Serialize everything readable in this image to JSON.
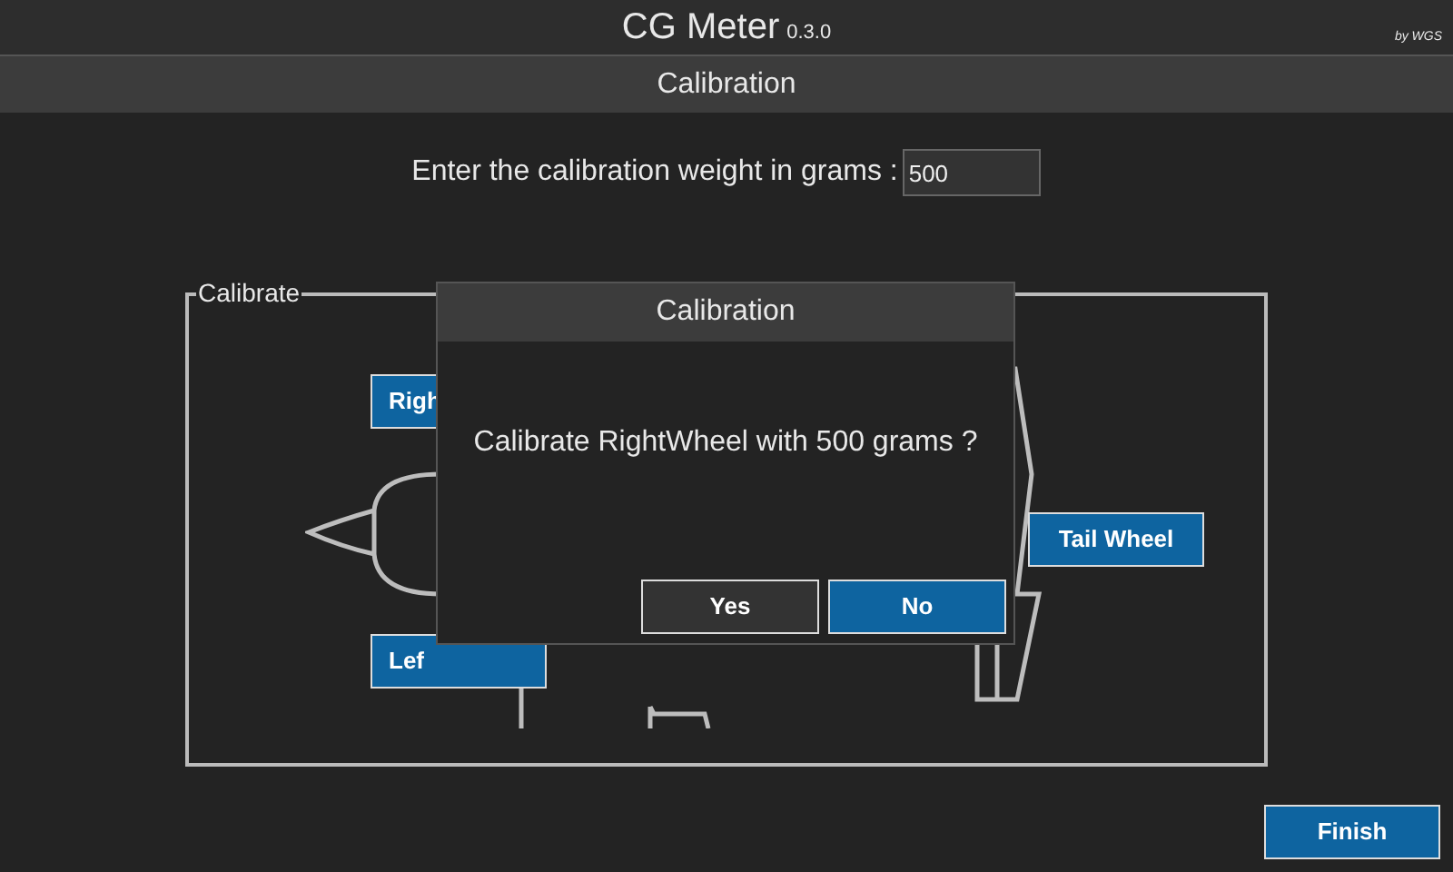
{
  "app": {
    "title": "CG Meter",
    "version": "0.3.0",
    "credit": "by WGS"
  },
  "section": {
    "title": "Calibration"
  },
  "weight": {
    "label": "Enter the calibration weight in grams :",
    "value": "500"
  },
  "calibrate": {
    "legend": "Calibrate",
    "buttons": [
      {
        "kind": "right",
        "label": "Righ"
      },
      {
        "kind": "left",
        "label": "Lef"
      },
      {
        "kind": "tail",
        "label": "Tail Wheel"
      }
    ]
  },
  "dialog": {
    "title": "Calibration",
    "message": "Calibrate RightWheel with 500 grams ?",
    "buttons": [
      {
        "label": "Yes",
        "primary": false
      },
      {
        "label": "No",
        "primary": true
      }
    ]
  },
  "finish": {
    "label": "Finish"
  }
}
